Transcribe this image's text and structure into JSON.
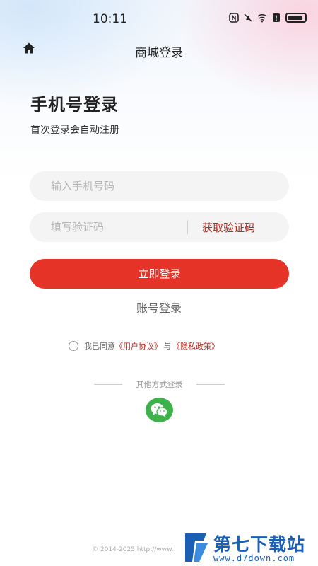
{
  "status_bar": {
    "time": "10:11"
  },
  "header": {
    "title": "商城登录",
    "home_icon": "home-icon"
  },
  "page": {
    "heading": "手机号登录",
    "subheading": "首次登录会自动注册"
  },
  "form": {
    "phone_placeholder": "输入手机号码",
    "phone_value": "",
    "code_placeholder": "填写验证码",
    "code_value": "",
    "get_code_label": "获取验证码",
    "login_button": "立即登录",
    "account_login": "账号登录"
  },
  "agreement": {
    "prefix": "我已同意",
    "user_agreement": "《用户协议》",
    "and": "与",
    "privacy_policy": "《隐私政策》",
    "checked": false
  },
  "other_login": {
    "label": "其他方式登录",
    "icon": "wechat-icon"
  },
  "footer": {
    "copyright": "© 2014-2025 http://www."
  },
  "watermark": {
    "title": "第七下载站",
    "url": "www.d7down.com"
  },
  "colors": {
    "accent": "#e63328",
    "link": "#b52a1f",
    "wechat": "#3db24a",
    "input_bg": "#f4f4f4"
  }
}
